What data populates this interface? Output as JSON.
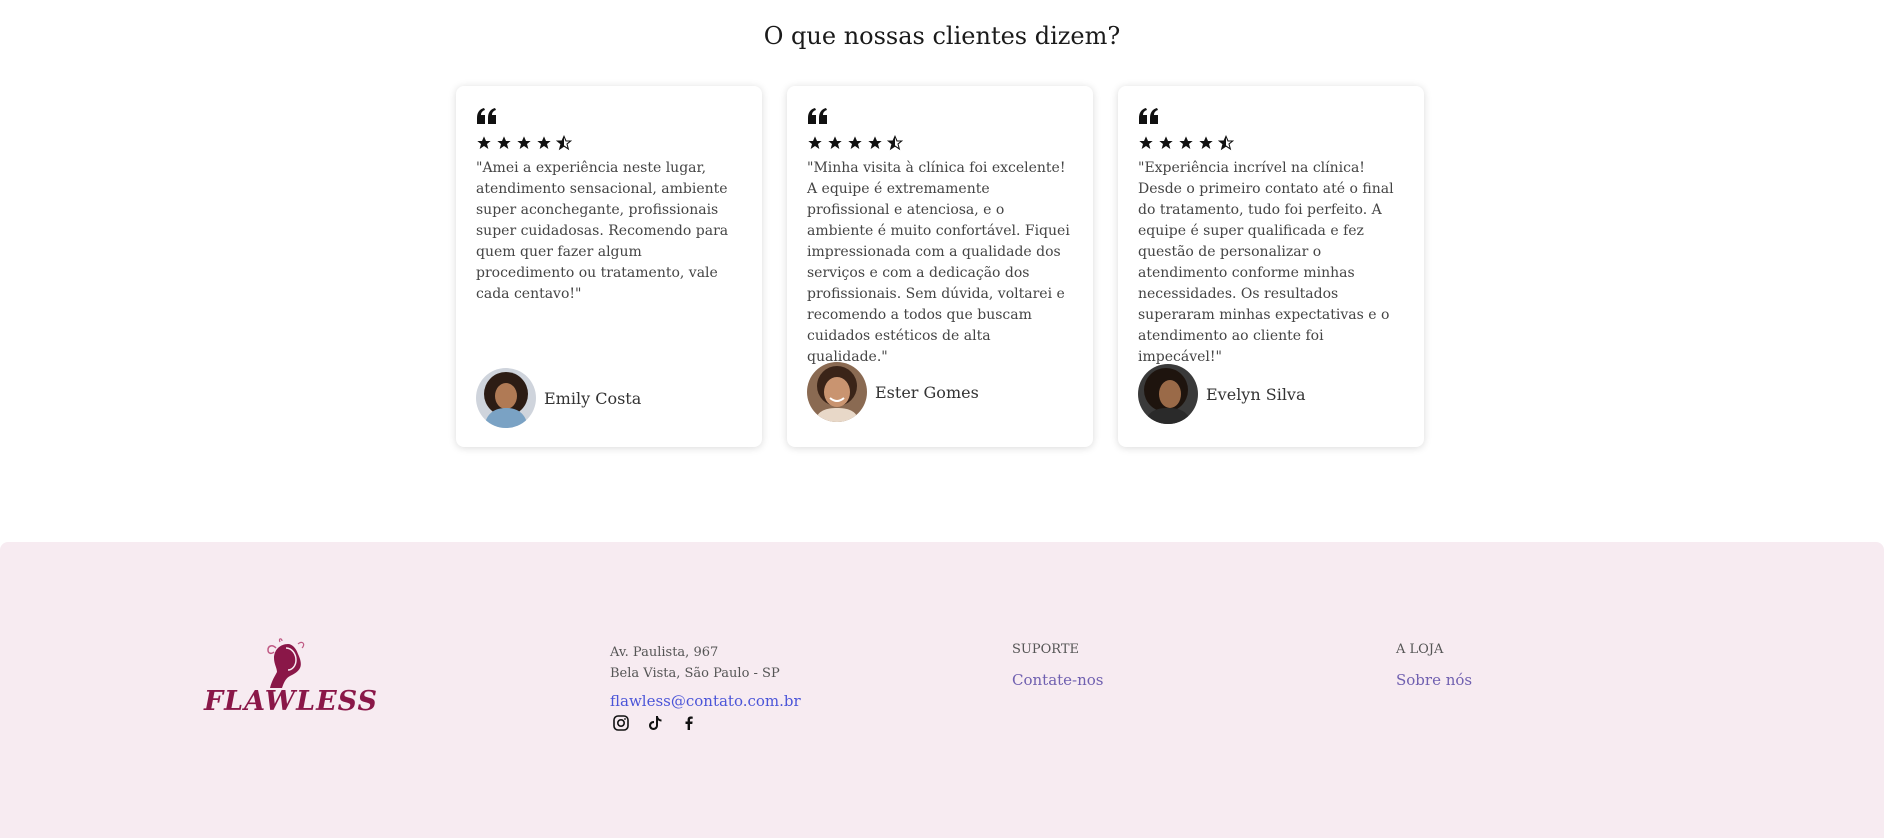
{
  "testimonials": {
    "title": "O que nossas clientes dizem?",
    "cards": [
      {
        "rating": 4.5,
        "text": "\"Amei a experiência neste lugar, atendimento sensacional, ambiente super aconchegante, profissionais super cuidadosas. Recomendo para quem quer fazer algum procedimento ou tratamento, vale cada centavo!\"",
        "name": "Emily Costa"
      },
      {
        "rating": 4.5,
        "text": "\"Minha visita à clínica foi excelente! A equipe é extremamente profissional e atenciosa, e o ambiente é muito confortável. Fiquei impressionada com a qualidade dos serviços e com a dedicação dos profissionais. Sem dúvida, voltarei e recomendo a todos que buscam cuidados estéticos de alta qualidade.\"",
        "name": "Ester Gomes"
      },
      {
        "rating": 4.5,
        "text": "\"Experiência incrível na clínica! Desde o primeiro contato até o final do tratamento, tudo foi perfeito. A equipe é super qualificada e fez questão de personalizar o atendimento conforme minhas necessidades. Os resultados superaram minhas expectativas e o atendimento ao cliente foi impecável!\"",
        "name": "Evelyn Silva"
      }
    ]
  },
  "footer": {
    "logo_text": "FLAWLESS",
    "address_line1": "Av. Paulista, 967",
    "address_line2": "Bela Vista, São Paulo - SP",
    "email": "flawless@contato.com.br",
    "social": [
      "instagram-icon",
      "tiktok-icon",
      "facebook-icon"
    ],
    "support": {
      "title": "SUPORTE",
      "link": "Contate-nos"
    },
    "store": {
      "title": "A LOJA",
      "link": "Sobre nós"
    }
  },
  "colors": {
    "footer_bg": "#f7ebf1",
    "brand": "#8a1748",
    "email_link": "#4b55d8",
    "footer_link": "#7060b0"
  }
}
